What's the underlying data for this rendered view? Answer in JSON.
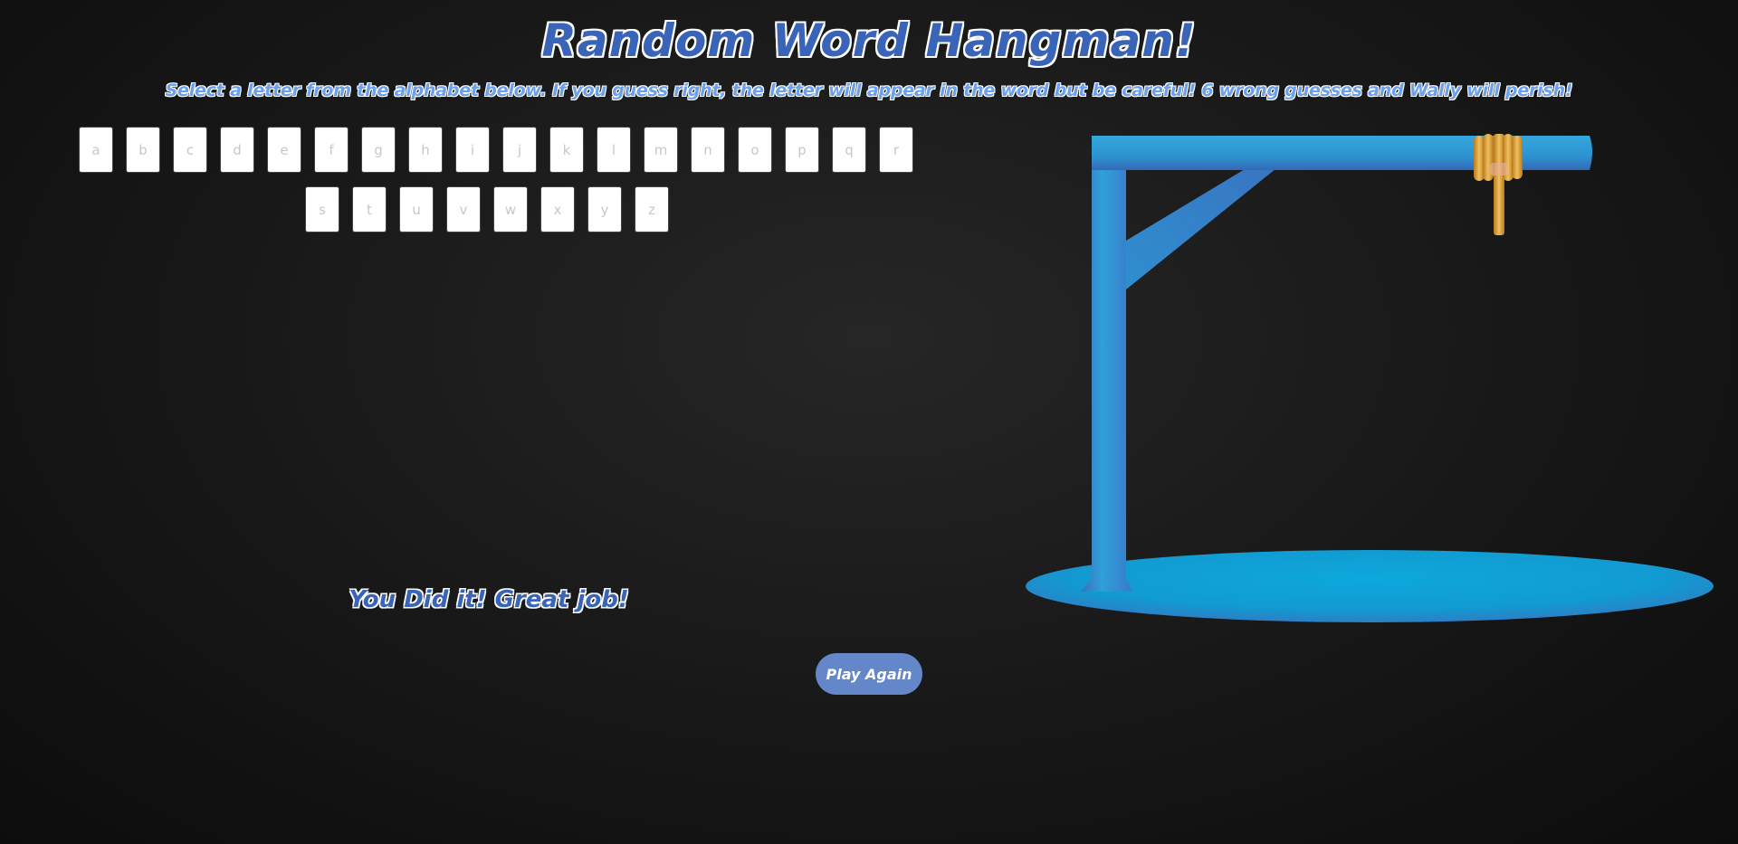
{
  "header": {
    "title": "Random Word Hangman!",
    "instructions": "Select a letter from the alphabet below. If you guess right, the letter will appear in the word but be careful! 6 wrong guesses and Wally will perish!"
  },
  "alphabet": {
    "row1": [
      "a",
      "b",
      "c",
      "d",
      "e",
      "f",
      "g",
      "h",
      "i",
      "j",
      "k",
      "l",
      "m",
      "n",
      "o",
      "p",
      "q",
      "r"
    ],
    "row2": [
      "s",
      "t",
      "u",
      "v",
      "w",
      "x",
      "y",
      "z"
    ]
  },
  "status": {
    "message": "You Did it! Great job!"
  },
  "actions": {
    "play_again_label": "Play Again"
  },
  "colors": {
    "title": "#3a64b8",
    "subtitle": "#6aa0ee",
    "button": "#6487c9",
    "gallows": "#2aa3d8",
    "rope": "#d9a030"
  }
}
